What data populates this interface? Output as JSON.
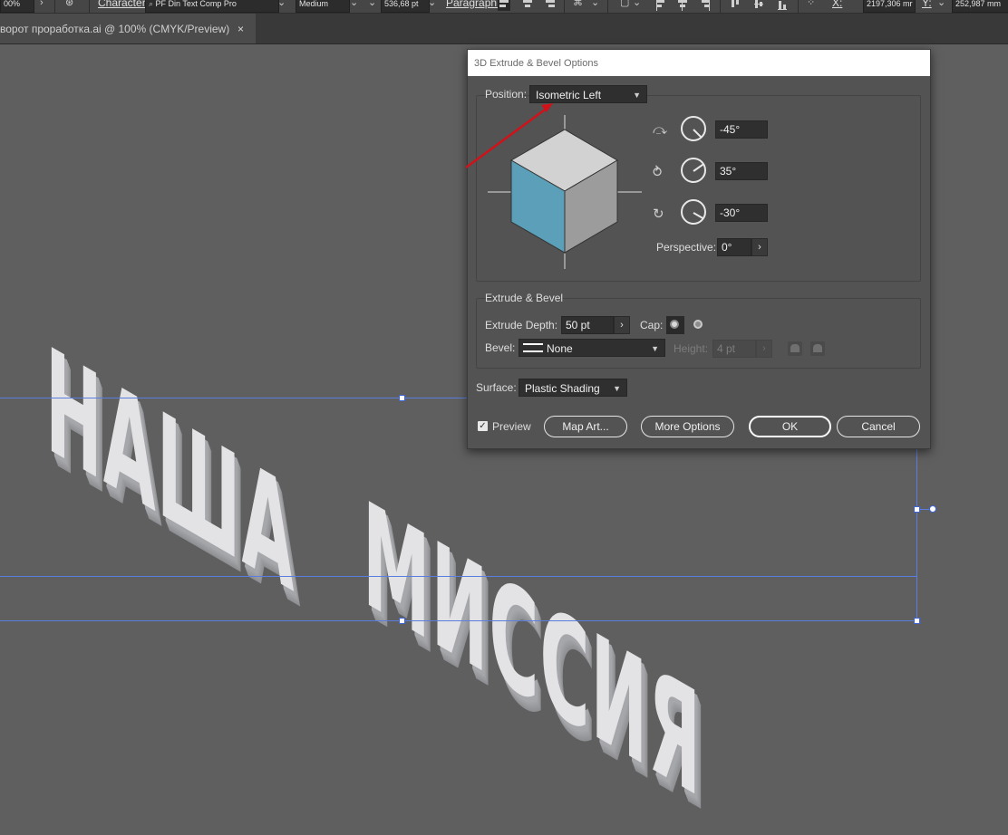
{
  "control_bar": {
    "zoom": "00%",
    "character_label": "Character:",
    "font_family": "PF Din Text Comp Pro",
    "font_style": "Medium",
    "font_size": "536,68 pt",
    "paragraph_label": "Paragraph:",
    "x_label": "X:",
    "x_value": "2197,306 mr",
    "y_label": "Y:",
    "y_value": "252,987 mm"
  },
  "document_tab": {
    "title": "ворот проработка.ai @ 100% (CMYK/Preview)",
    "close": "×"
  },
  "canvas": {
    "line1": [
      "Н",
      "А",
      "Ш",
      "А"
    ],
    "line2": [
      "М",
      "И",
      "С",
      "С",
      "И",
      "Я"
    ]
  },
  "dialog": {
    "title": "3D Extrude & Bevel Options",
    "position_label": "Position:",
    "position_value": "Isometric Left",
    "rotation_x": "-45°",
    "rotation_y": "35°",
    "rotation_z": "-30°",
    "perspective_label": "Perspective:",
    "perspective_value": "0°",
    "extrude_group": "Extrude & Bevel",
    "extrude_depth_label": "Extrude Depth:",
    "extrude_depth_value": "50 pt",
    "cap_label": "Cap:",
    "bevel_label": "Bevel:",
    "bevel_value": "None",
    "height_label": "Height:",
    "height_value": "4 pt",
    "surface_label": "Surface:",
    "surface_value": "Plastic Shading",
    "preview_label": "Preview",
    "preview_checked": true,
    "buttons": {
      "map_art": "Map Art...",
      "more_options": "More Options",
      "ok": "OK",
      "cancel": "Cancel"
    },
    "cube_colors": {
      "top": "#d2d2d2",
      "left": "#5ba0b8",
      "right": "#9c9c9c"
    }
  },
  "annotation_color": "#d0121a",
  "guide_color": "#5a7ee0"
}
